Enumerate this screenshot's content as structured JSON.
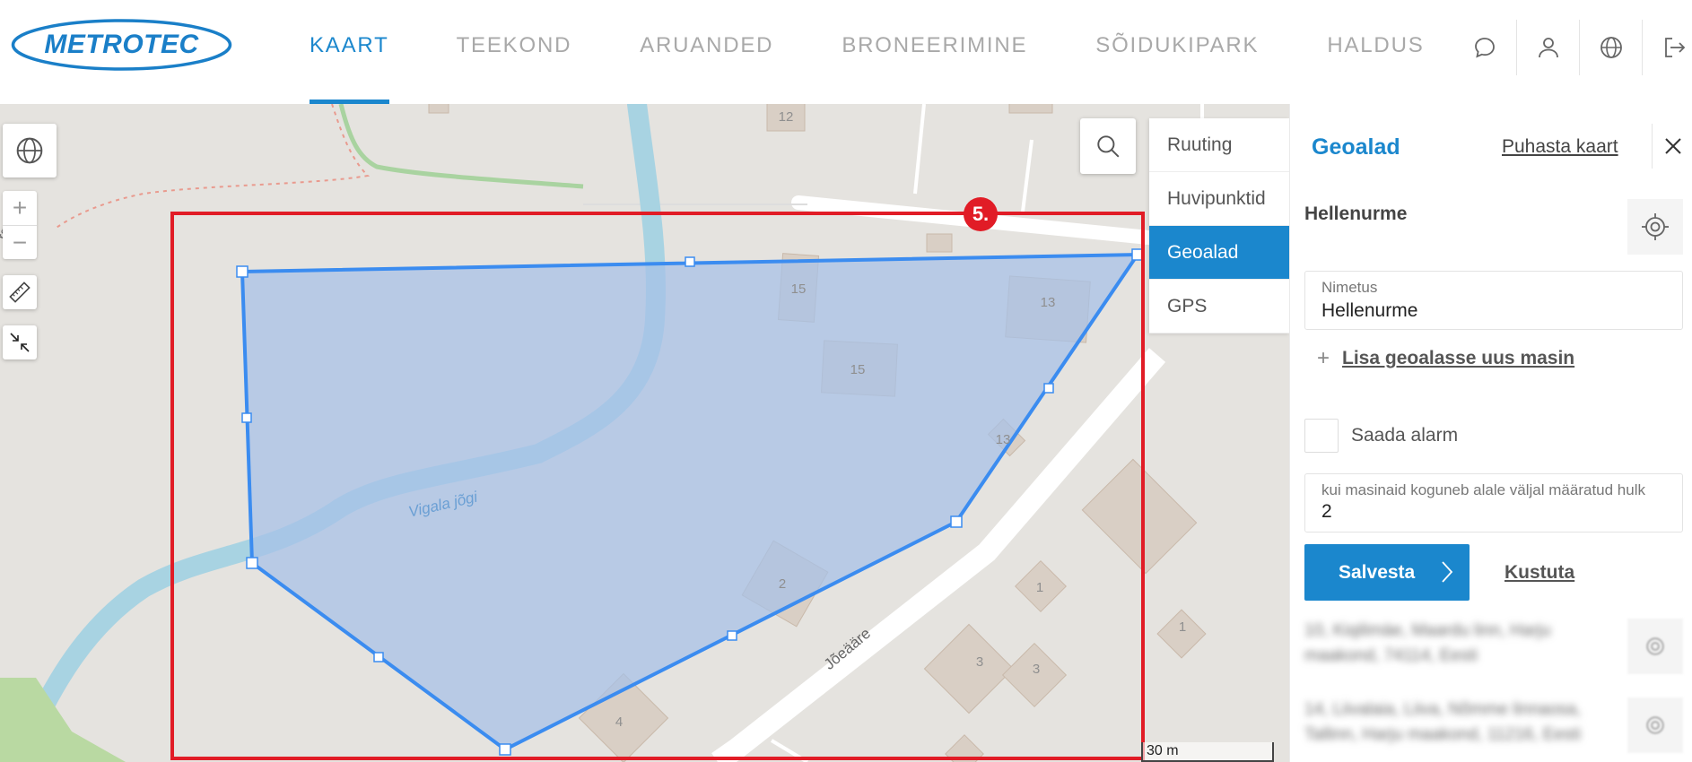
{
  "header": {
    "logo_text": "METROTEC",
    "nav": [
      {
        "label": "KAART",
        "active": true
      },
      {
        "label": "TEEKOND",
        "active": false
      },
      {
        "label": "ARUANDED",
        "active": false
      },
      {
        "label": "BRONEERIMINE",
        "active": false
      },
      {
        "label": "SÕIDUKIPARK",
        "active": false
      },
      {
        "label": "HALDUS",
        "active": false
      }
    ],
    "icons": [
      "chat-icon",
      "user-icon",
      "globe-icon",
      "logout-icon"
    ]
  },
  "map": {
    "zoom_in": "+",
    "zoom_out": "−",
    "step_badge": "5.",
    "scale_label": "30 m",
    "labels": {
      "river": "Vigala jõgi",
      "road": "Jõeääre",
      "edge_road": "rga",
      "house_12": "12",
      "house_15a": "15",
      "house_15b": "15",
      "house_13a": "13",
      "house_13b": "13",
      "house_2": "2",
      "house_1a": "1",
      "house_1b": "1",
      "house_3a": "3",
      "house_3b": "3",
      "house_4": "4"
    },
    "colors": {
      "polygon_fill": "#a6c0e8",
      "polygon_stroke": "#3b8cf0",
      "highlight_box": "#e11c26",
      "river": "#a8d3e2"
    }
  },
  "layers": {
    "items": [
      {
        "label": "Ruuting",
        "active": false
      },
      {
        "label": "Huvipunktid",
        "active": false
      },
      {
        "label": "Geoalad",
        "active": true
      },
      {
        "label": "GPS",
        "active": false
      }
    ]
  },
  "panel": {
    "title": "Geoalad",
    "clear_label": "Puhasta kaart",
    "zone_name": "Hellenurme",
    "name_field": {
      "label": "Nimetus",
      "value": "Hellenurme"
    },
    "add_machine_label": "Lisa geoalasse uus masin",
    "alarm_label": "Saada alarm",
    "alarm_checked": false,
    "threshold_field": {
      "label": "kui masinaid koguneb alale väljal määratud hulk",
      "value": "2"
    },
    "save_label": "Salvesta",
    "delete_label": "Kustuta",
    "list": [
      {
        "address": "10, Kiqilimäe, Maardu linn, Harju maakond, 74114, Eesti"
      },
      {
        "address": "14, Liivalaia, Liiva, Nõmme linnaosa, Tallinn, Harju maakond, 11216, Eesti"
      }
    ]
  }
}
